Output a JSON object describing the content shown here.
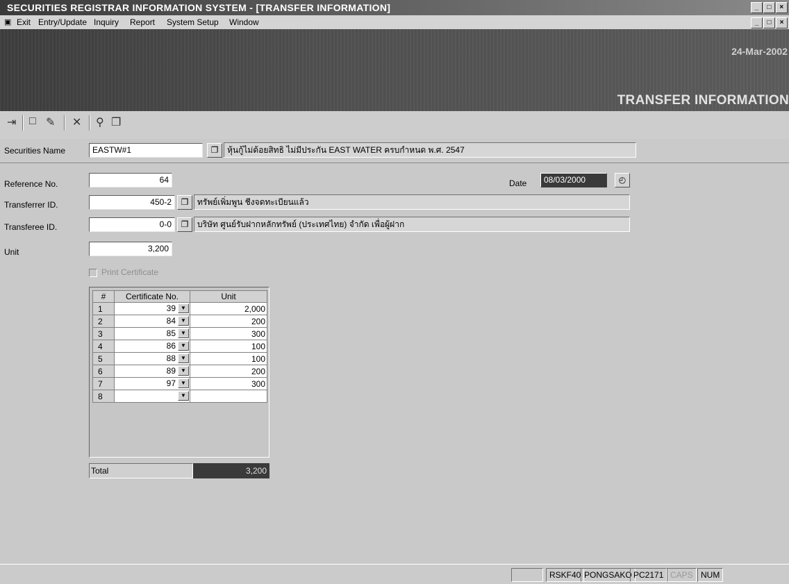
{
  "window": {
    "title": "SECURITIES REGISTRAR INFORMATION SYSTEM - [TRANSFER INFORMATION]",
    "min": "_",
    "max": "8",
    "close": "X"
  },
  "menu": {
    "items": [
      "Exit",
      "Entry/Update",
      "Inquiry",
      "Report",
      "System Setup",
      "Window"
    ]
  },
  "banner": {
    "date": "24-Mar-2002",
    "title": "TRANSFER INFORMATION"
  },
  "form": {
    "securities_name_label": "Securities Name",
    "securities_name": "EASTW#1",
    "securities_desc": "หุ้นกู้ไม่ด้อยสิทธิ ไม่มีประกัน EAST WATER ครบกำหนด พ.ศ. 2547",
    "reference_label": "Reference No.",
    "reference_no": "64",
    "date_label": "Date",
    "date": "08/03/2000",
    "transferrer_label": "Transferrer ID.",
    "transferrer_id": "450-2",
    "transferrer_desc": "ทรัพย์เพิ่มพูน ชีงจดทะเบียนแล้ว",
    "transferee_label": "Transferee ID.",
    "transferee_id": "0-0",
    "transferee_desc": "บริษัท ศูนย์รับฝากหลักทรัพย์ (ประเทศไทย) จำกัด เพื่อผู้ฝาก",
    "unit_label": "Unit",
    "unit": "3,200",
    "print_certificate_label": "Print Certificate"
  },
  "grid": {
    "headers": [
      "#",
      "Certificate No.",
      "Unit"
    ],
    "rows": [
      {
        "n": "1",
        "cert": "39",
        "unit": "2,000"
      },
      {
        "n": "2",
        "cert": "84",
        "unit": "200"
      },
      {
        "n": "3",
        "cert": "85",
        "unit": "300"
      },
      {
        "n": "4",
        "cert": "86",
        "unit": "100"
      },
      {
        "n": "5",
        "cert": "88",
        "unit": "100"
      },
      {
        "n": "6",
        "cert": "89",
        "unit": "200"
      },
      {
        "n": "7",
        "cert": "97",
        "unit": "300"
      },
      {
        "n": "8",
        "cert": "",
        "unit": ""
      }
    ],
    "total_label": "Total",
    "total": "3,200"
  },
  "status": {
    "cells": [
      "RSKF40",
      "PONGSAKO",
      "PC2171",
      "CAPS",
      "NUM"
    ]
  }
}
